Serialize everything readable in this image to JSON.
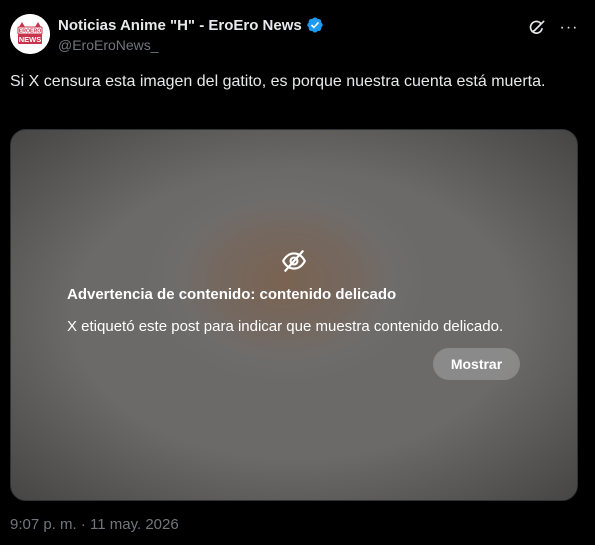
{
  "author": {
    "name": "Noticias Anime \"H\" - EroEro News",
    "handle": "@EroEroNews_",
    "avatar_text_top": "EROERO",
    "avatar_text_bottom": "NEWS",
    "verified": true,
    "verified_color": "#1d9bf0"
  },
  "header_icons": {
    "grok": "grok-icon",
    "more": "···"
  },
  "tweet": {
    "text": "Si X censura esta imagen del gatito, es porque nuestra cuenta está muerta."
  },
  "media_warning": {
    "icon": "eye-off-icon",
    "title": "Advertencia de contenido: contenido delicado",
    "description": "X etiquetó este post para indicar que muestra contenido delicado.",
    "button_label": "Mostrar"
  },
  "timestamp": "9:07 p. m. · 11 may. 2026",
  "colors": {
    "background": "#000000",
    "text": "#e7e9ea",
    "muted": "#71767b",
    "accent": "#1d9bf0"
  }
}
